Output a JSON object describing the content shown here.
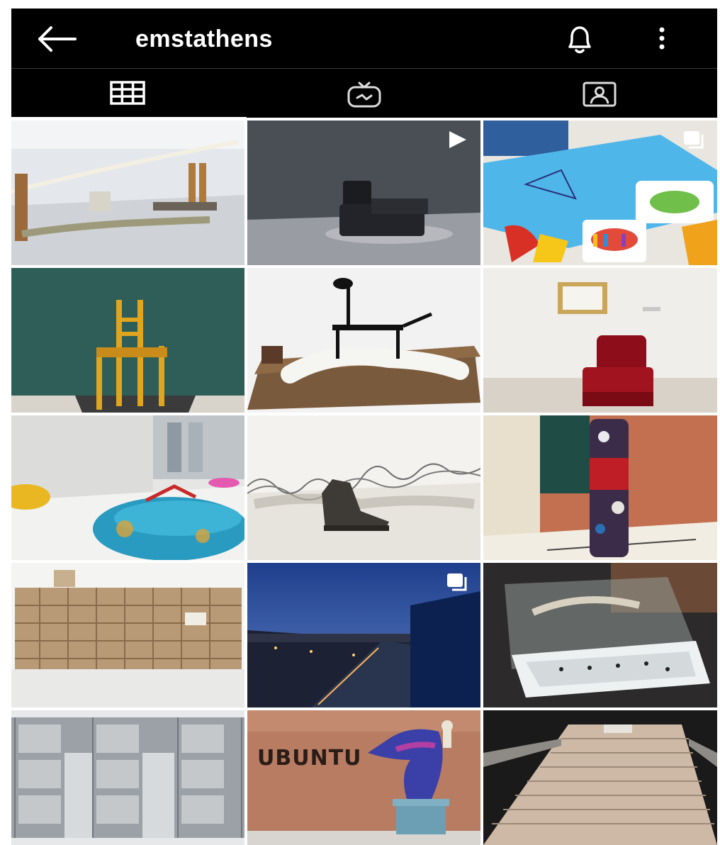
{
  "header": {
    "title": "emstathens",
    "back_icon": "arrow-left-icon",
    "notify_icon": "bell-icon",
    "more_icon": "more-vertical-icon"
  },
  "tabs": [
    {
      "name": "grid",
      "icon": "grid-icon",
      "active": true
    },
    {
      "name": "igtv",
      "icon": "tv-icon",
      "active": false
    },
    {
      "name": "tagged",
      "icon": "tagged-person-icon",
      "active": false
    }
  ],
  "posts": [
    {
      "subject": "gallery-loom-installation",
      "badge": null
    },
    {
      "subject": "black-armchair",
      "badge": "video-icon"
    },
    {
      "subject": "crayons-blue-paper",
      "badge": "carousel-icon"
    },
    {
      "subject": "yellow-wooden-chair",
      "badge": null
    },
    {
      "subject": "figure-with-chair-and-lamp",
      "badge": null
    },
    {
      "subject": "red-velvet-chair",
      "badge": null
    },
    {
      "subject": "blue-fabric-sack",
      "badge": null
    },
    {
      "subject": "boot-and-barbed-wire",
      "badge": null
    },
    {
      "subject": "textile-column",
      "badge": null
    },
    {
      "subject": "wooden-shelf-structure",
      "badge": null
    },
    {
      "subject": "night-terrace-view",
      "badge": "carousel-icon"
    },
    {
      "subject": "glass-vitrine-installation",
      "badge": null
    },
    {
      "subject": "metal-cabinets",
      "badge": null
    },
    {
      "subject": "ubuntu-sculpture",
      "badge": null,
      "caption": "UBUNTU"
    },
    {
      "subject": "staircase-text-installation",
      "badge": null
    }
  ],
  "colors": {
    "bar": "#000000",
    "icon": "#ffffff",
    "background": "#ffffff"
  }
}
